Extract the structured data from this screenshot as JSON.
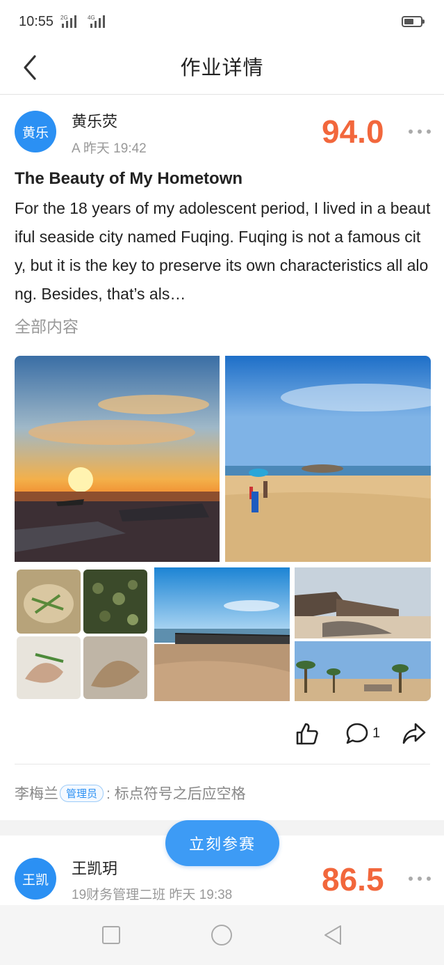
{
  "status_bar": {
    "time": "10:55",
    "signal_1": "2G",
    "signal_2": "4G",
    "battery_level": 0.6
  },
  "nav": {
    "title": "作业详情",
    "back_icon": "chevron-left-icon"
  },
  "post": {
    "avatar_text": "黄乐",
    "author": "黄乐荧",
    "meta": "A 昨天 19:42",
    "score": "94.0",
    "title": "The Beauty of My Hometown",
    "body": "For the 18 years of my adolescent period, I lived in a beautiful seaside city named Fuqing. Fuqing is not a famous city, but it is the key to preserve its own characteristics all along. Besides, that’s als…",
    "read_all": "全部内容",
    "photos": [
      "sunset-boats-photo",
      "beach-people-photo",
      "seafood-collage-photo",
      "shore-nets-photo",
      "coast-resort-collage-photo"
    ],
    "comment_count": "1"
  },
  "reply": {
    "author": "李梅兰",
    "role": "管理员",
    "text": ": 标点符号之后应空格"
  },
  "join_button": "立刻参赛",
  "next_post": {
    "avatar_text": "王凯",
    "author": "王凯玥",
    "meta": "19财务管理二班 昨天 19:38",
    "score": "86.5"
  },
  "colors": {
    "accent_blue": "#2b90f3",
    "score_orange": "#f2673c",
    "button_blue": "#3d9bf5"
  }
}
